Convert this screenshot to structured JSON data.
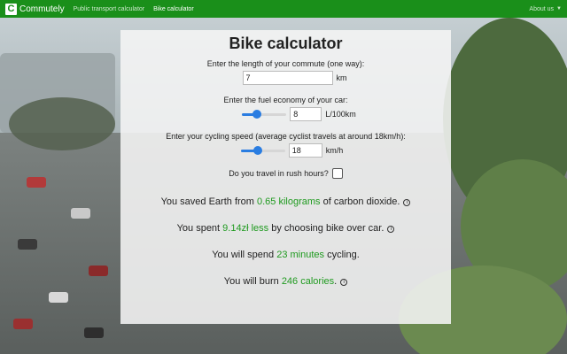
{
  "navbar": {
    "brand_letter": "C",
    "brand": "Commutely",
    "links": [
      "Public transport calculator",
      "Bike calculator"
    ],
    "active_link": "Bike calculator",
    "about": "About us"
  },
  "calculator": {
    "title": "Bike calculator",
    "commute": {
      "label": "Enter the length of your commute (one way):",
      "value": "7",
      "unit": "km"
    },
    "fuel": {
      "label": "Enter the fuel economy of your car:",
      "value": "8",
      "unit": "L/100km",
      "slider_level": 0.3
    },
    "speed": {
      "label": "Enter your cycling speed (average cyclist travels at around 18km/h):",
      "value": "18",
      "unit": "km/h",
      "slider_level": 0.35
    },
    "rush": {
      "label": "Do you travel in rush hours?",
      "checked": false
    }
  },
  "results": {
    "co2": {
      "pre": "You saved Earth from ",
      "value": "0.65 kilograms",
      "post": " of carbon dioxide."
    },
    "money": {
      "pre": "You spent ",
      "value": "9.14zł less",
      "post": " by choosing bike over car."
    },
    "time": {
      "pre": "You will spend ",
      "value": "23 minutes",
      "post": " cycling."
    },
    "calories": {
      "pre": "You will burn ",
      "value": "246 calories",
      "post": "."
    }
  },
  "colors": {
    "nav": "#1a8f1a",
    "highlight": "#1f9a1f",
    "slider": "#2a7de1"
  }
}
